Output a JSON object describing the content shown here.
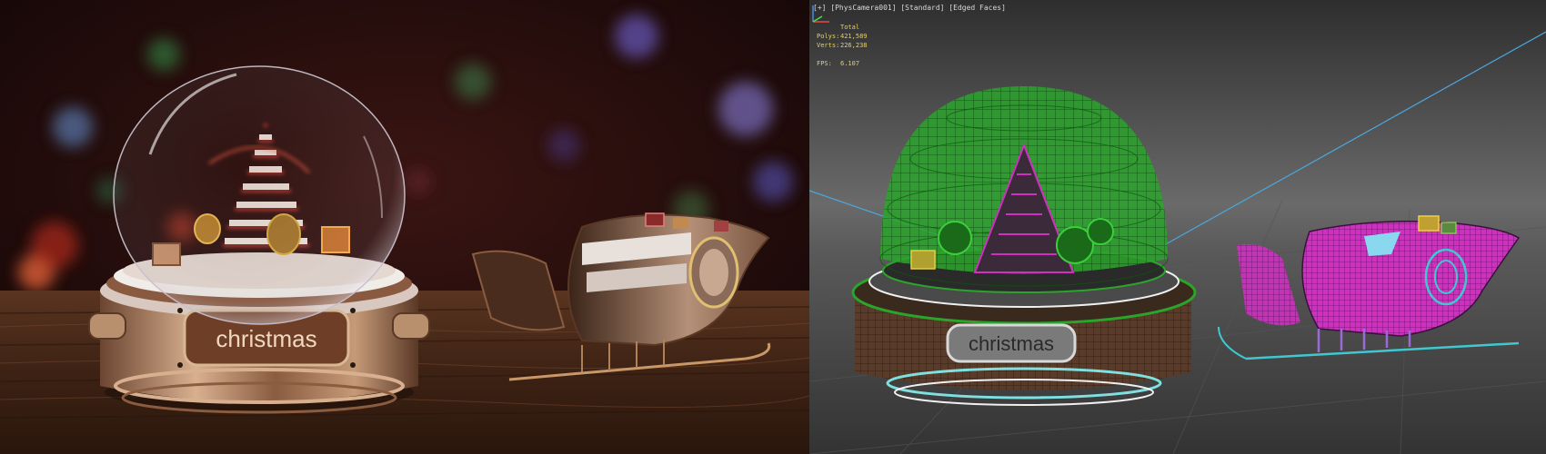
{
  "render": {
    "plaque_text": "christmas"
  },
  "viewport": {
    "label": "[+] [PhysCamera001] [Standard] [Edged Faces]",
    "stats": {
      "total_label": "Total",
      "polys_label": "Polys:",
      "polys_value": "421,589",
      "verts_label": "Verts:",
      "verts_value": "226,238",
      "fps_label": "FPS:",
      "fps_value": "6.107"
    },
    "plaque_text": "christmas"
  }
}
